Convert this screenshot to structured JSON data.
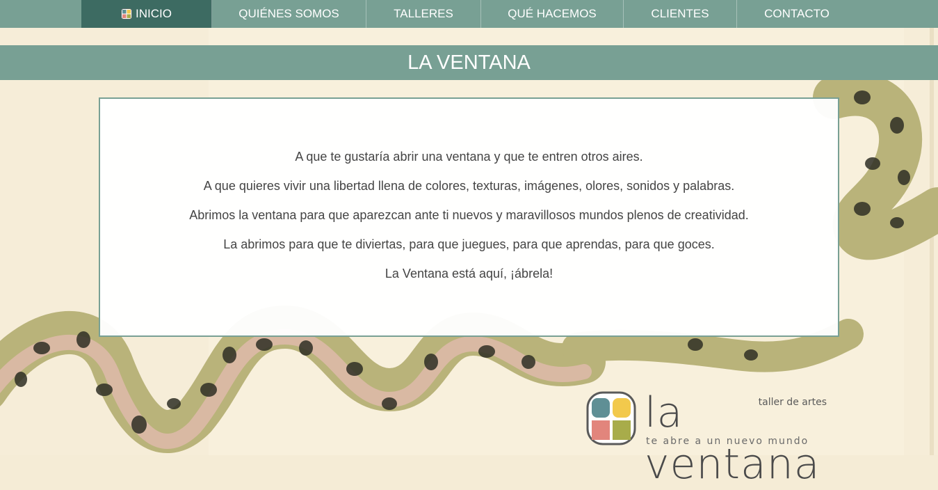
{
  "nav": {
    "items": [
      {
        "label": "INICIO",
        "active": true
      },
      {
        "label": "QUIÉNES SOMOS",
        "active": false
      },
      {
        "label": "TALLERES",
        "active": false
      },
      {
        "label": "QUÉ HACEMOS",
        "active": false
      },
      {
        "label": "CLIENTES",
        "active": false
      },
      {
        "label": "CONTACTO",
        "active": false
      }
    ]
  },
  "page": {
    "title": "LA VENTANA"
  },
  "content": {
    "lines": [
      "A que te gustaría abrir una ventana y que te entren otros aires.",
      "A que quieres vivir una libertad llena de colores, texturas, imágenes, olores, sonidos y palabras.",
      "Abrimos la ventana para que aparezcan ante ti nuevos y maravillosos mundos plenos de creatividad.",
      "La abrimos para que te diviertas, para que juegues, para que aprendas, para que goces.",
      "La Ventana está aquí, ¡ábrela!"
    ]
  },
  "logo": {
    "tagline_top": "taller de artes",
    "name": "la ventana",
    "tagline_bottom": "te abre a un nuevo mundo"
  },
  "colors": {
    "nav_bg": "#78a094",
    "nav_active": "#3d6b62",
    "background": "#f5ecd6",
    "text": "#444444"
  }
}
